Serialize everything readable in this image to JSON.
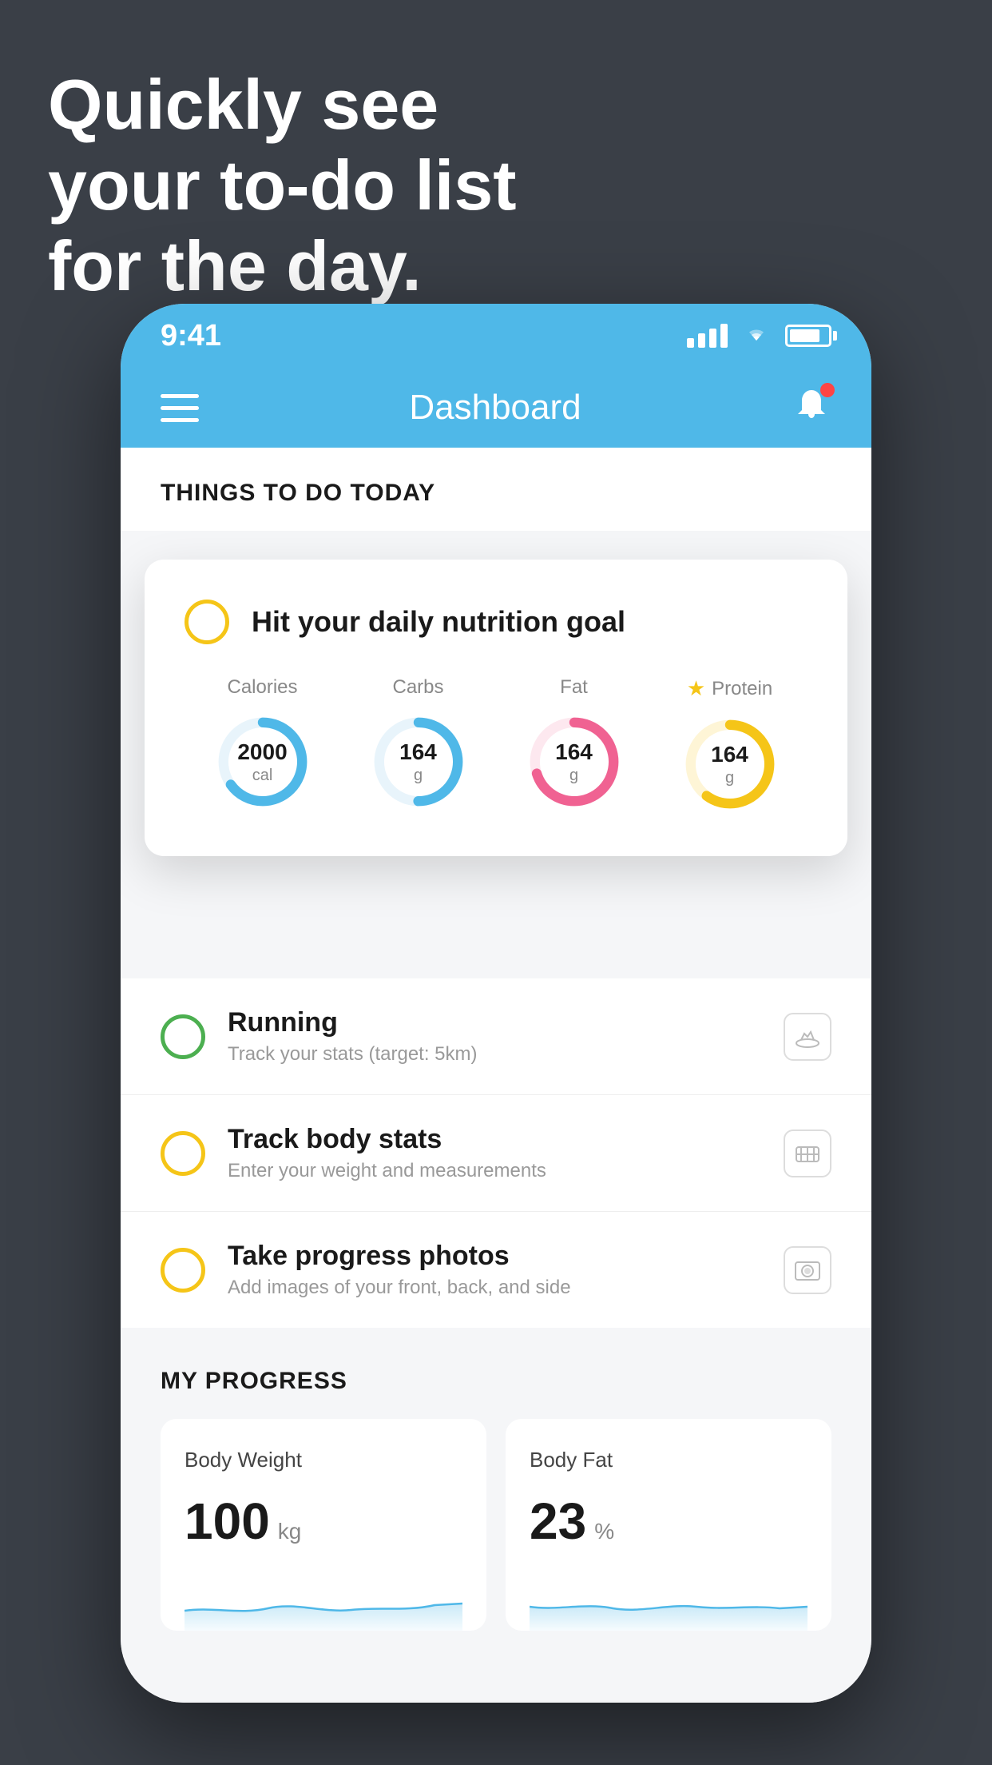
{
  "headline": {
    "line1": "Quickly see",
    "line2": "your to-do list",
    "line3": "for the day."
  },
  "status_bar": {
    "time": "9:41"
  },
  "nav": {
    "title": "Dashboard"
  },
  "things_section": {
    "title": "THINGS TO DO TODAY"
  },
  "floating_card": {
    "main_label": "Hit your daily nutrition goal",
    "nutrition": [
      {
        "label": "Calories",
        "value": "2000",
        "unit": "cal",
        "color": "#4fb8e8",
        "track_pct": 65,
        "starred": false
      },
      {
        "label": "Carbs",
        "value": "164",
        "unit": "g",
        "color": "#4fb8e8",
        "track_pct": 50,
        "starred": false
      },
      {
        "label": "Fat",
        "value": "164",
        "unit": "g",
        "color": "#f06292",
        "track_pct": 70,
        "starred": false
      },
      {
        "label": "Protein",
        "value": "164",
        "unit": "g",
        "color": "#f5c518",
        "track_pct": 60,
        "starred": true
      }
    ]
  },
  "todo_items": [
    {
      "title": "Running",
      "subtitle": "Track your stats (target: 5km)",
      "circle_color": "#4caf50",
      "icon": "👟"
    },
    {
      "title": "Track body stats",
      "subtitle": "Enter your weight and measurements",
      "circle_color": "#f5c518",
      "icon": "⚖"
    },
    {
      "title": "Take progress photos",
      "subtitle": "Add images of your front, back, and side",
      "circle_color": "#f5c518",
      "icon": "👤"
    }
  ],
  "progress_section": {
    "title": "MY PROGRESS",
    "cards": [
      {
        "title": "Body Weight",
        "value": "100",
        "unit": "kg"
      },
      {
        "title": "Body Fat",
        "value": "23",
        "unit": "%"
      }
    ]
  }
}
